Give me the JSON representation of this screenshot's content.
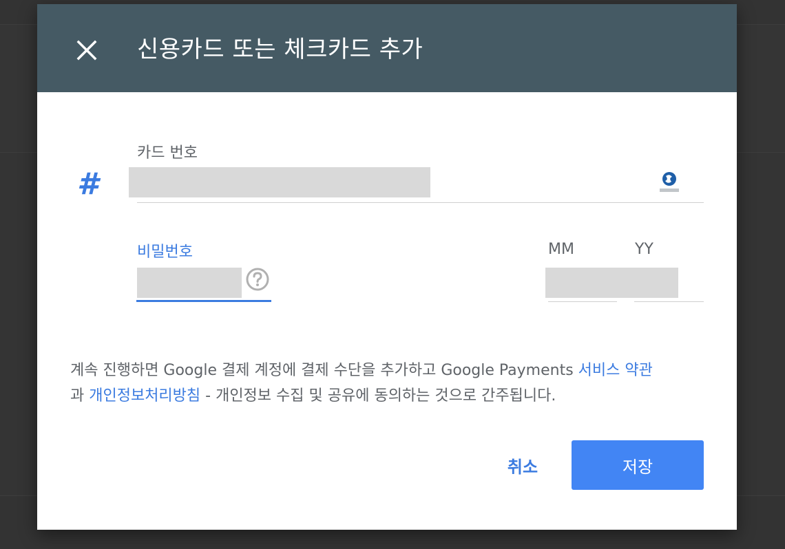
{
  "dialog": {
    "title": "신용카드 또는 체크카드 추가"
  },
  "card": {
    "label": "카드 번호",
    "icon": "hash-icon",
    "bank_logo": "shinhan-card-logo"
  },
  "password": {
    "label": "비밀번호",
    "help_icon": "help-icon"
  },
  "expiry": {
    "month_label": "MM",
    "year_label": "YY"
  },
  "terms": {
    "text_1": "계속 진행하면 Google 결제 계정에 결제 수단을 추가하고 Google Payments ",
    "link_1": "서비스 약관",
    "text_2": "과 ",
    "link_2": "개인정보처리방침",
    "text_3": " - 개인정보 수집 및 공유에 동의하는 것으로 간주됩니다."
  },
  "buttons": {
    "cancel": "취소",
    "save": "저장"
  },
  "colors": {
    "header_bg": "#455a64",
    "accent": "#4285f4",
    "link": "#3b7be0"
  }
}
